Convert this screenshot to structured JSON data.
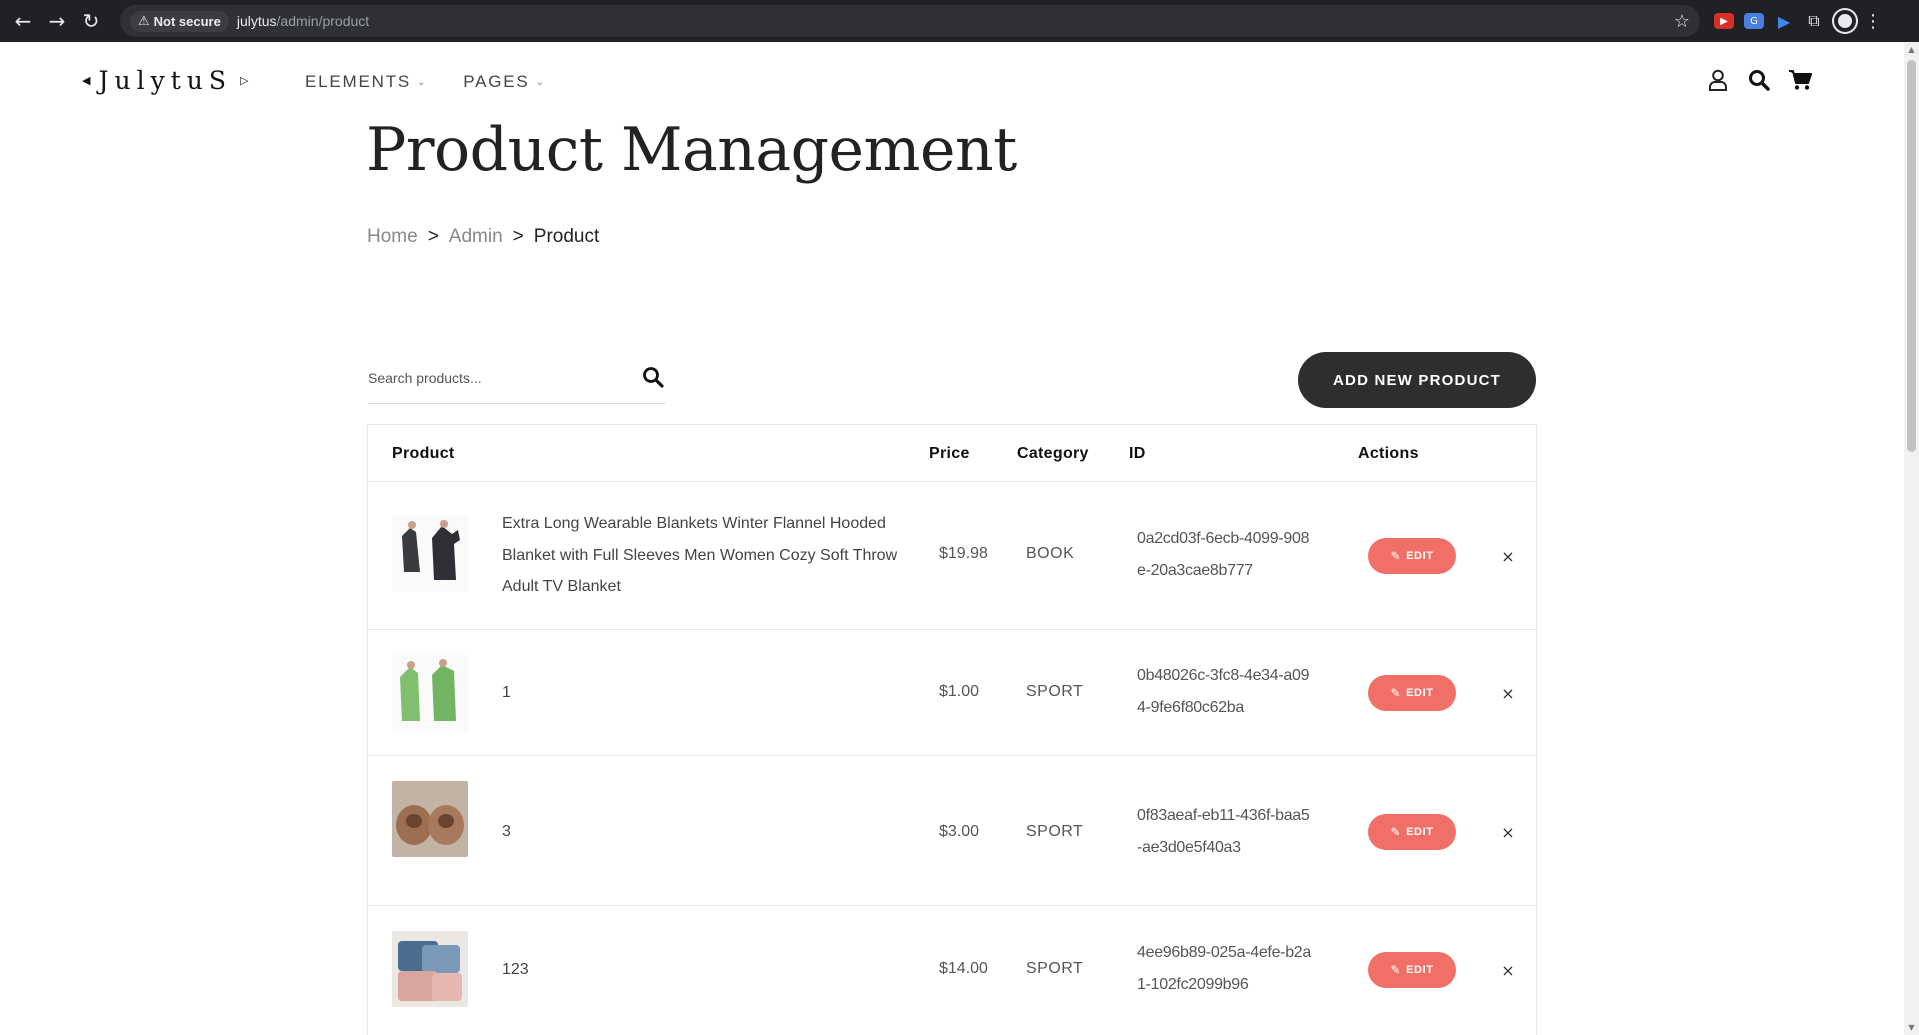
{
  "browser": {
    "secure_label": "Not secure",
    "url_host": "julytus",
    "url_path": "/admin/product"
  },
  "header": {
    "logo": "JulytuS",
    "nav": [
      "ELEMENTS",
      "PAGES"
    ]
  },
  "page": {
    "title": "Product Management",
    "breadcrumb": [
      "Home",
      "Admin",
      "Product"
    ],
    "search_placeholder": "Search products...",
    "add_button": "ADD NEW PRODUCT"
  },
  "table": {
    "columns": [
      "Product",
      "Price",
      "Category",
      "ID",
      "Actions"
    ],
    "edit_label": "EDIT",
    "delete_symbol": "×",
    "rows": [
      {
        "name": "Extra Long Wearable Blankets Winter Flannel Hooded Blanket with Full Sleeves Men Women Cozy Soft Throw Adult TV Blanket",
        "price": "$19.98",
        "category": "BOOK",
        "id": "0a2cd03f-6ecb-4099-908e-20a3cae8b777"
      },
      {
        "name": "1",
        "price": "$1.00",
        "category": "SPORT",
        "id": "0b48026c-3fc8-4e34-a094-9fe6f80c62ba"
      },
      {
        "name": "3",
        "price": "$3.00",
        "category": "SPORT",
        "id": "0f83aeaf-eb11-436f-baa5-ae3d0e5f40a3"
      },
      {
        "name": "123",
        "price": "$14.00",
        "category": "SPORT",
        "id": "4ee96b89-025a-4efe-b2a1-102fc2099b96"
      }
    ]
  },
  "colors": {
    "accent": "#f07067",
    "dark_button": "#2e2e2e",
    "chrome_bg": "#202124"
  }
}
